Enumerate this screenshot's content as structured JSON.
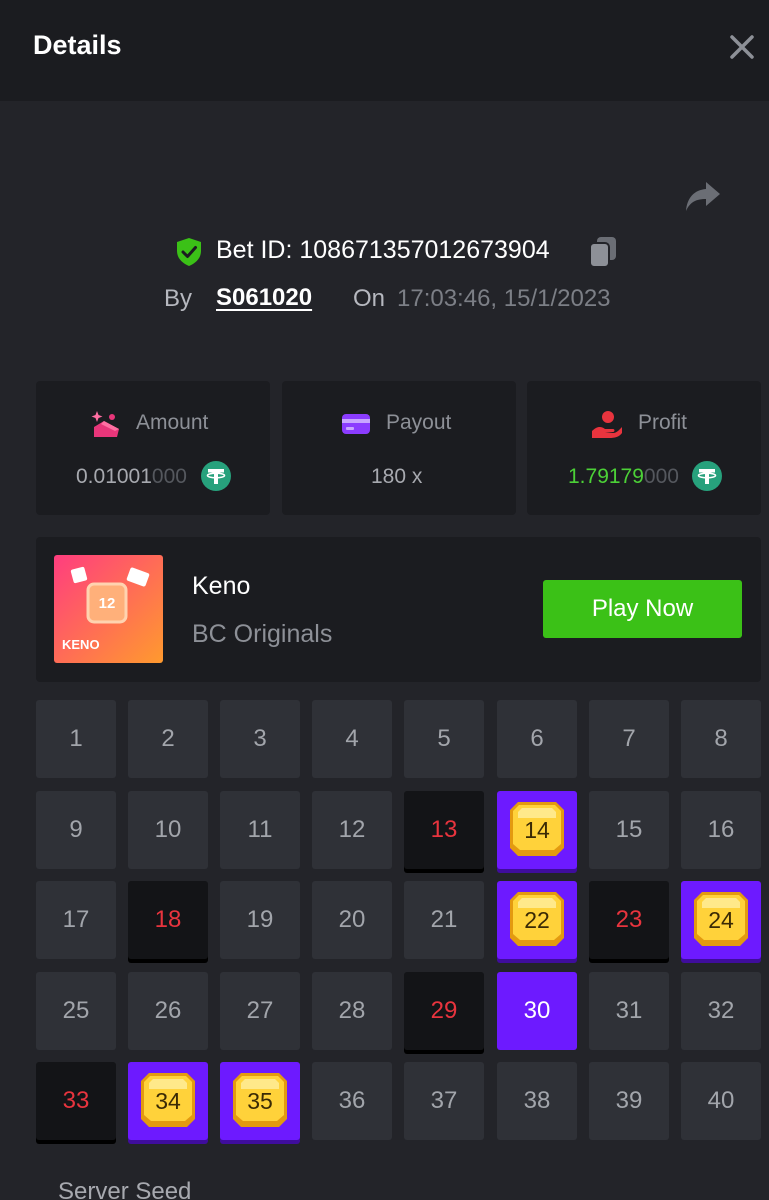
{
  "header": {
    "title": "Details",
    "close_icon": "close-icon"
  },
  "share_icon": "share-icon",
  "bet": {
    "bet_id_text": "Bet ID: 108671357012673904",
    "by_label": "By",
    "username": "S061020",
    "on_label": "On",
    "timestamp": "17:03:46, 15/1/2023"
  },
  "stats": {
    "amount": {
      "label": "Amount",
      "value_main": "0.01001",
      "value_dim": "000",
      "icon": "amount-icon",
      "coin": "tether-coin-icon"
    },
    "payout": {
      "label": "Payout",
      "value": "180 x",
      "icon": "payout-card-icon"
    },
    "profit": {
      "label": "Profit",
      "value_main": "1.79179",
      "value_dim": "000",
      "icon": "profit-hand-icon",
      "coin": "tether-coin-icon"
    }
  },
  "game": {
    "name": "Keno",
    "provider": "BC Originals",
    "thumb_label": "KENO",
    "thumb_number": "12",
    "play_label": "Play Now"
  },
  "colors": {
    "accent_purple": "#6d1aff",
    "play_green": "#3bc117",
    "miss_red": "#e8343e",
    "profit_green": "#4cd137"
  },
  "keno_tiles": [
    {
      "n": "1",
      "state": "normal"
    },
    {
      "n": "2",
      "state": "normal"
    },
    {
      "n": "3",
      "state": "normal"
    },
    {
      "n": "4",
      "state": "normal"
    },
    {
      "n": "5",
      "state": "normal"
    },
    {
      "n": "6",
      "state": "normal"
    },
    {
      "n": "7",
      "state": "normal"
    },
    {
      "n": "8",
      "state": "normal"
    },
    {
      "n": "9",
      "state": "normal"
    },
    {
      "n": "10",
      "state": "normal"
    },
    {
      "n": "11",
      "state": "normal"
    },
    {
      "n": "12",
      "state": "normal"
    },
    {
      "n": "13",
      "state": "miss"
    },
    {
      "n": "14",
      "state": "hit"
    },
    {
      "n": "15",
      "state": "normal"
    },
    {
      "n": "16",
      "state": "normal"
    },
    {
      "n": "17",
      "state": "normal"
    },
    {
      "n": "18",
      "state": "miss"
    },
    {
      "n": "19",
      "state": "normal"
    },
    {
      "n": "20",
      "state": "normal"
    },
    {
      "n": "21",
      "state": "normal"
    },
    {
      "n": "22",
      "state": "hit"
    },
    {
      "n": "23",
      "state": "miss"
    },
    {
      "n": "24",
      "state": "hit"
    },
    {
      "n": "25",
      "state": "normal"
    },
    {
      "n": "26",
      "state": "normal"
    },
    {
      "n": "27",
      "state": "normal"
    },
    {
      "n": "28",
      "state": "normal"
    },
    {
      "n": "29",
      "state": "miss"
    },
    {
      "n": "30",
      "state": "pick"
    },
    {
      "n": "31",
      "state": "normal"
    },
    {
      "n": "32",
      "state": "normal"
    },
    {
      "n": "33",
      "state": "miss"
    },
    {
      "n": "34",
      "state": "hit"
    },
    {
      "n": "35",
      "state": "hit"
    },
    {
      "n": "36",
      "state": "normal"
    },
    {
      "n": "37",
      "state": "normal"
    },
    {
      "n": "38",
      "state": "normal"
    },
    {
      "n": "39",
      "state": "normal"
    },
    {
      "n": "40",
      "state": "normal"
    }
  ],
  "server_seed_label": "Server Seed"
}
